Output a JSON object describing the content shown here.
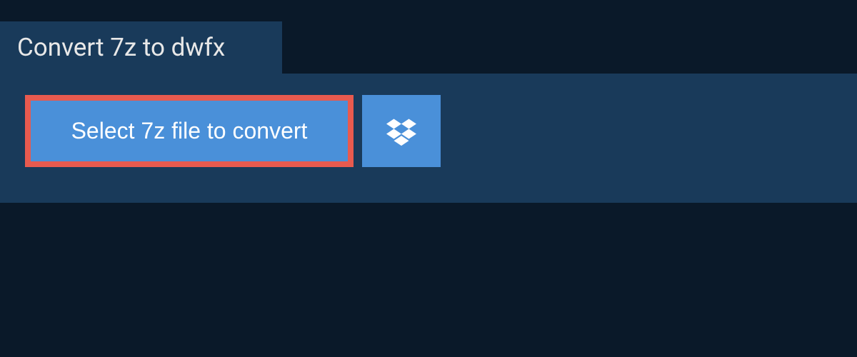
{
  "header": {
    "title": "Convert 7z to dwfx"
  },
  "actions": {
    "select_file_label": "Select 7z file to convert"
  },
  "colors": {
    "background": "#0a1929",
    "panel": "#193a5a",
    "button": "#4a90d9",
    "highlight_border": "#e85a4f",
    "text": "#ffffff"
  }
}
